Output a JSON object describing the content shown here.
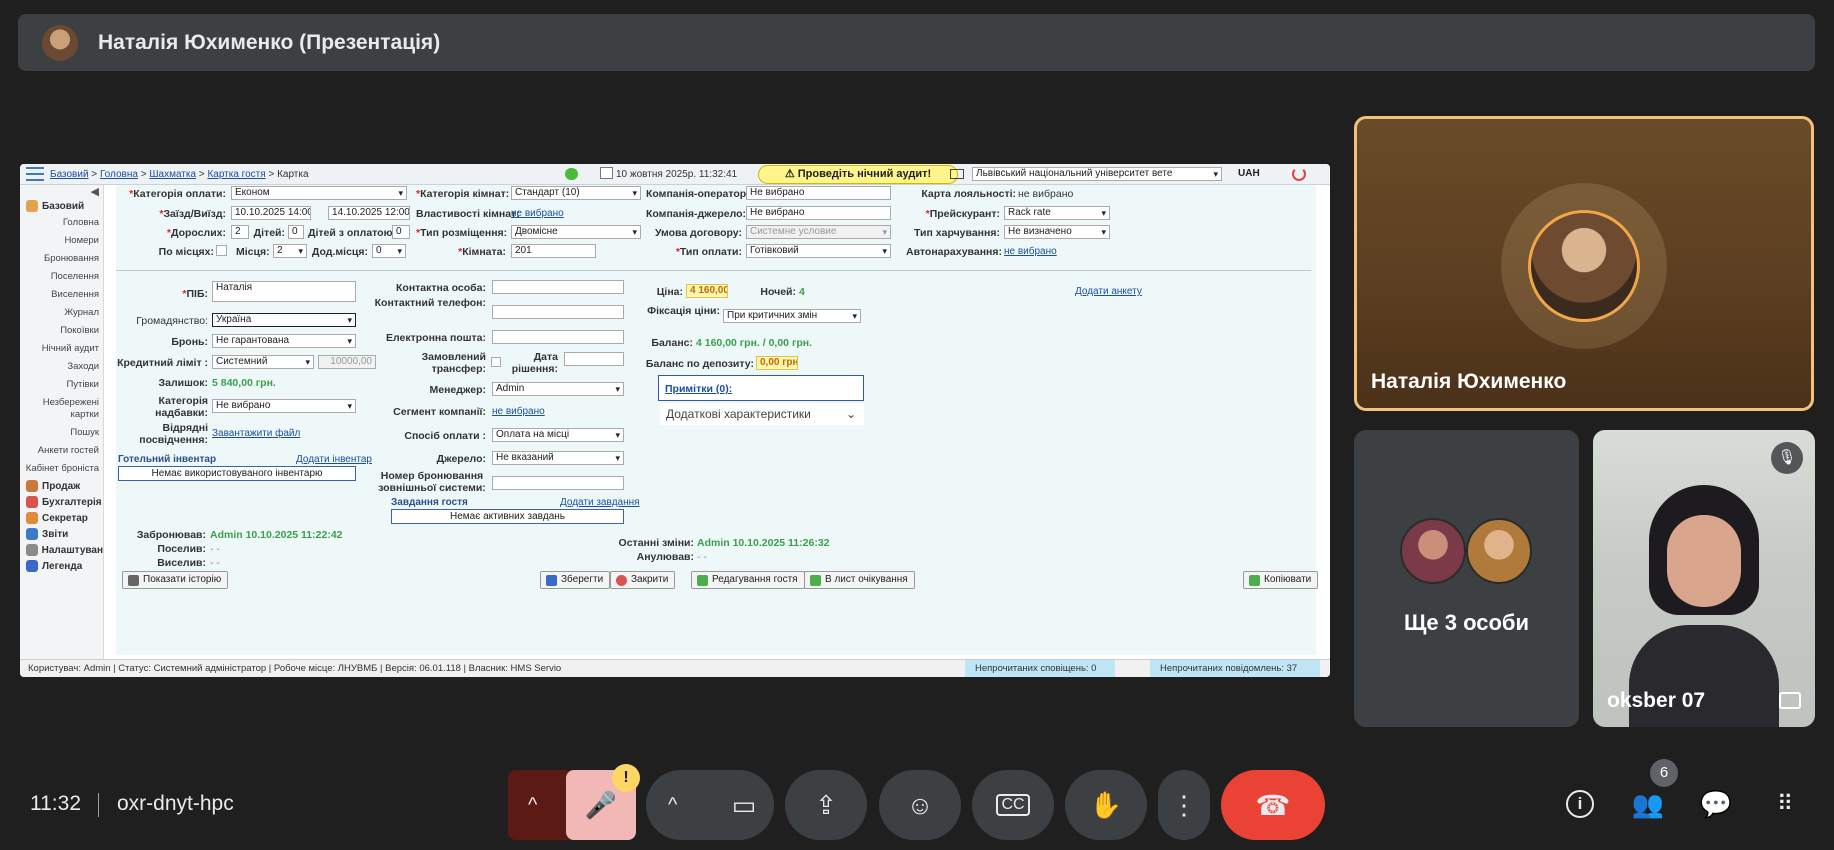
{
  "meeting": {
    "presenter_title": "Наталія Юхименко (Презентація)",
    "time": "11:32",
    "code": "oxr-dnyt-hpc",
    "participants_badge": "6"
  },
  "tiles": [
    {
      "name": "Наталія Юхименко"
    },
    {
      "more": "Ще 3 особи"
    },
    {
      "name": "oksber 07"
    }
  ],
  "controls": {
    "raise_arrow": "^",
    "mic_icon": "mic-off-icon",
    "warn": "!",
    "more_arrow": "^",
    "camera_icon": "camera-icon",
    "present_icon": "present-icon",
    "emoji_icon": "emoji-icon",
    "cc_icon": "cc-icon",
    "hand_icon": "hand-icon",
    "more_icon": "more-vert-icon",
    "leave_icon": "leave-call-icon"
  },
  "app": {
    "breadcrumbs": [
      "Базовий",
      "Головна",
      "Шахматка",
      "Картка гостя"
    ],
    "breadcrumb_current": "Картка",
    "date": "10 жовтня 2025р.  11:32:41",
    "audit": "⚠ Проведіть нічний аудит!",
    "university": "Львівський національний університет вете",
    "currency": "UAH",
    "sidebar": {
      "base": "Базовий",
      "items": [
        "Головна",
        "Номери",
        "Бронювання",
        "Поселення",
        "Виселення",
        "Журнал",
        "Покоївки",
        "Нічний аудит",
        "Заходи",
        "Путівки",
        "Незбережені картки",
        "Пошук",
        "Анкети гостей",
        "Кабінет броніста"
      ],
      "groups": [
        "Продаж",
        "Бухгалтерія",
        "Секретар",
        "Звіти",
        "Налаштуван",
        "Легенда"
      ]
    },
    "form": {
      "pay_cat_lbl": "Категорія оплати:",
      "pay_cat": "Економ",
      "room_cat_lbl": "Категорія кімнат:",
      "room_cat": "Стандарт (10)",
      "operator_lbl": "Компанія-оператор:",
      "operator": "Не вибрано",
      "loyalty_lbl": "Карта лояльності:",
      "loyalty": "не вибрано",
      "checkin_lbl": "Заїзд/Виїзд:",
      "checkin": "10.10.2025 14:00",
      "checkout": "14.10.2025 12:00",
      "room_props_lbl": "Властивості кімнат:",
      "room_props": "не вибрано",
      "source_co_lbl": "Компанія-джерело:",
      "source_co": "Не вибрано",
      "price_list_lbl": "Прейскурант:",
      "price_list": "Rack rate",
      "adults_lbl": "Дорослих:",
      "adults": "2",
      "kids_lbl": "Дітей:",
      "kids": "0",
      "kids_paid_lbl": "Дітей з оплатою:",
      "kids_paid": "0",
      "placement_lbl": "Тип розміщення:",
      "placement": "Двомісне",
      "contract_lbl": "Умова договору:",
      "contract": "Системне условие",
      "meals_lbl": "Тип харчування:",
      "meals": "Не визначено",
      "by_places_lbl": "По місцях:",
      "places_lbl": "Місця:",
      "places": "2",
      "extra_lbl": "Дод.місця:",
      "extra": "0",
      "room_lbl": "Кімната:",
      "room": "201",
      "pay_type_lbl": "Тип оплати:",
      "pay_type": "Готівковий",
      "auto_lbl": "Автонарахування:",
      "auto": "не вибрано",
      "name_lbl": "ПІБ:",
      "name": "Наталія",
      "citizen_lbl": "Громадянство:",
      "citizen": "Україна",
      "booking_lbl": "Бронь:",
      "booking": "Не гарантована",
      "credit_lbl": "Кредитний ліміт :",
      "credit": "Системний",
      "credit_val": "10000,00",
      "rest_lbl": "Залишок:",
      "rest": "5 840,00 грн.",
      "surcharge_lbl": "Категорія надбавки:",
      "surcharge": "Не вибрано",
      "scan_lbl": "Відряднi посвідчення:",
      "scan": "Завантажити файл",
      "inventory_h": "Готельний інвентар",
      "inventory_add": "Додати інвентар",
      "inventory_empty": "Немає використовуваного інвентарю",
      "contact_lbl": "Контактна особа:",
      "phone_lbl": "Контактний телефон:",
      "email_lbl": "Електронна пошта:",
      "transfer_lbl": "Замовлений трансфер:",
      "decision_lbl": "Дата рішення:",
      "manager_lbl": "Менеджер:",
      "manager": "Admin",
      "segment_lbl": "Сегмент компанії:",
      "segment": "не вибрано",
      "paymode_lbl": "Спосіб оплати :",
      "paymode": "Оплата на місці",
      "source_lbl": "Джерело:",
      "source": "Не вказаний",
      "ext_lbl": "Номер бронювання зовнішньої системи:",
      "tasks_h": "Завдання гостя",
      "tasks_add": "Додати завдання",
      "tasks_empty": "Немає активних завдань",
      "price_lbl": "Ціна:",
      "price": "4 160,00",
      "nights_lbl": "Ночей:",
      "nights": "4",
      "add_form": "Додати анкету",
      "fix_lbl": "Фіксація ціни:",
      "fix": "При критичних змін",
      "balance_lbl": "Баланс:",
      "balance": "4 160,00 грн.  /  0,00 грн.",
      "deposit_lbl": "Баланс по депозиту:",
      "deposit": "0,00 грн.",
      "notes": "Примітки (0):",
      "extra_chars": "Додаткові характеристики",
      "booked_lbl": "Забронював:",
      "booked": "Admin   10.10.2025 11:22:42",
      "settled_lbl": "Поселив:",
      "settled": "-  -",
      "evicted_lbl": "Виселив:",
      "evicted": "-  -",
      "changed_lbl": "Останні зміни:",
      "changed": "Admin   10.10.2025 11:26:32",
      "cancel_lbl": "Анулював:",
      "cancel": "-  -"
    },
    "buttons": {
      "history": "Показати історію",
      "save": "Зберегти",
      "close": "Закрити",
      "edit": "Редагування гостя",
      "wait": "В лист очікування",
      "copy": "Копіювати"
    },
    "status": {
      "user": "Користувач: Admin  |  Статус: Системний адміністратор  |  Робоче місце: ЛНУВМБ  |  Версія: 06.01.118  |  Власник: HMS Servio",
      "notif": "Непрочитаних сповіщень: 0",
      "msgs": "Непрочитаних повідомлень: 37"
    }
  }
}
